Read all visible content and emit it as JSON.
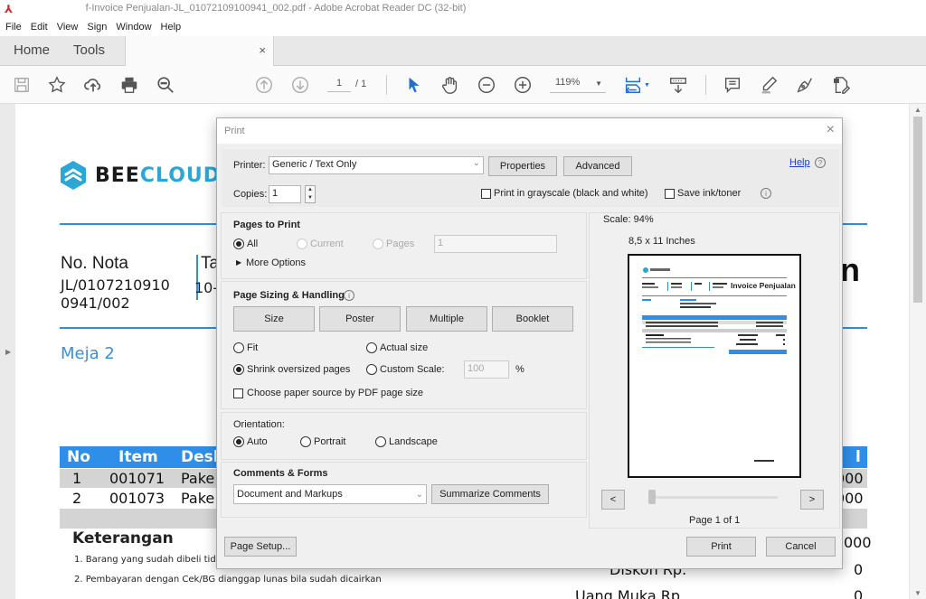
{
  "window": {
    "title": "f-Invoice Penjualan-JL_01072109100941_002.pdf - Adobe Acrobat Reader DC (32-bit)",
    "app_icon": "acrobat-icon"
  },
  "menu": [
    "File",
    "Edit",
    "View",
    "Sign",
    "Window",
    "Help"
  ],
  "tabs": {
    "home": "Home",
    "tools": "Tools",
    "doc_close": "×"
  },
  "toolbar": {
    "icons": [
      "save-icon",
      "bookmark-star-icon",
      "upload-cloud-icon",
      "print-icon",
      "search-icon",
      "prev-page-icon",
      "next-page-icon",
      "select-cursor-icon",
      "hand-icon",
      "zoom-out-icon",
      "zoom-in-icon",
      "fit-page-icon",
      "scroll-mode-icon",
      "comment-icon",
      "highlight-icon",
      "sign-icon",
      "fill-sign-icon"
    ],
    "page_current": "1",
    "page_total": "/ 1",
    "zoom_level": "119%"
  },
  "document": {
    "brand_bee": "BEE",
    "brand_cloud": "CLOUD",
    "nota_label": "No. Nota",
    "nota_value": "JL/01072109100941/002",
    "nota_line1": "JL/0107210910",
    "nota_line2": "0941/002",
    "tanggal_label_frag": "Ta",
    "tanggal_value_frag": "10-",
    "title_frag": "n",
    "meja": "Meja 2",
    "table": {
      "headers": [
        "No",
        "Item",
        "Desk",
        "l"
      ],
      "rows": [
        {
          "no": "1",
          "item": "001071",
          "desc": "Pake",
          "total": "000"
        },
        {
          "no": "2",
          "item": "001073",
          "desc": "Pake",
          "total": "000"
        }
      ]
    },
    "keterangan_title": "Keterangan",
    "notes": [
      "1. Barang yang sudah dibeli tid",
      "2. Pembayaran dengan Cek/BG dianggap lunas bila sudah dicairkan"
    ],
    "summary": [
      {
        "label": "",
        "value": "000"
      },
      {
        "label": "Diskon Rp.",
        "value": "0"
      },
      {
        "label": "Uang Muka Rp.",
        "value": "0"
      }
    ]
  },
  "print_dialog": {
    "title": "Print",
    "close": "×",
    "printer_label": "Printer:",
    "printer_value": "Generic / Text Only",
    "properties_btn": "Properties",
    "advanced_btn": "Advanced",
    "help_link": "Help",
    "copies_label": "Copies:",
    "copies_value": "1",
    "grayscale_label": "Print in grayscale (black and white)",
    "grayscale_checked": false,
    "save_ink_label": "Save ink/toner",
    "save_ink_checked": false,
    "pages_to_print": {
      "title": "Pages to Print",
      "all": "All",
      "current": "Current",
      "pages": "Pages",
      "pages_value": "1",
      "selected": "All",
      "more_options": "More Options"
    },
    "page_sizing": {
      "title": "Page Sizing & Handling",
      "buttons": [
        "Size",
        "Poster",
        "Multiple",
        "Booklet"
      ],
      "fit": "Fit",
      "actual_size": "Actual size",
      "shrink": "Shrink oversized pages",
      "custom_scale": "Custom Scale:",
      "custom_scale_value": "100",
      "percent": "%",
      "selected": "Shrink oversized pages",
      "paper_source": "Choose paper source by PDF page size",
      "paper_source_checked": false
    },
    "orientation": {
      "title": "Orientation:",
      "options": [
        "Auto",
        "Portrait",
        "Landscape"
      ],
      "selected": "Auto"
    },
    "comments_forms": {
      "title": "Comments & Forms",
      "value": "Document and Markups",
      "summarize_btn": "Summarize Comments"
    },
    "preview": {
      "scale": "Scale:  94%",
      "paper": "8,5 x 11 Inches",
      "preview_title": "Invoice Penjualan",
      "prev": "<",
      "next": ">",
      "page_info": "Page 1 of 1"
    },
    "page_setup_btn": "Page Setup...",
    "print_btn": "Print",
    "cancel_btn": "Cancel"
  }
}
